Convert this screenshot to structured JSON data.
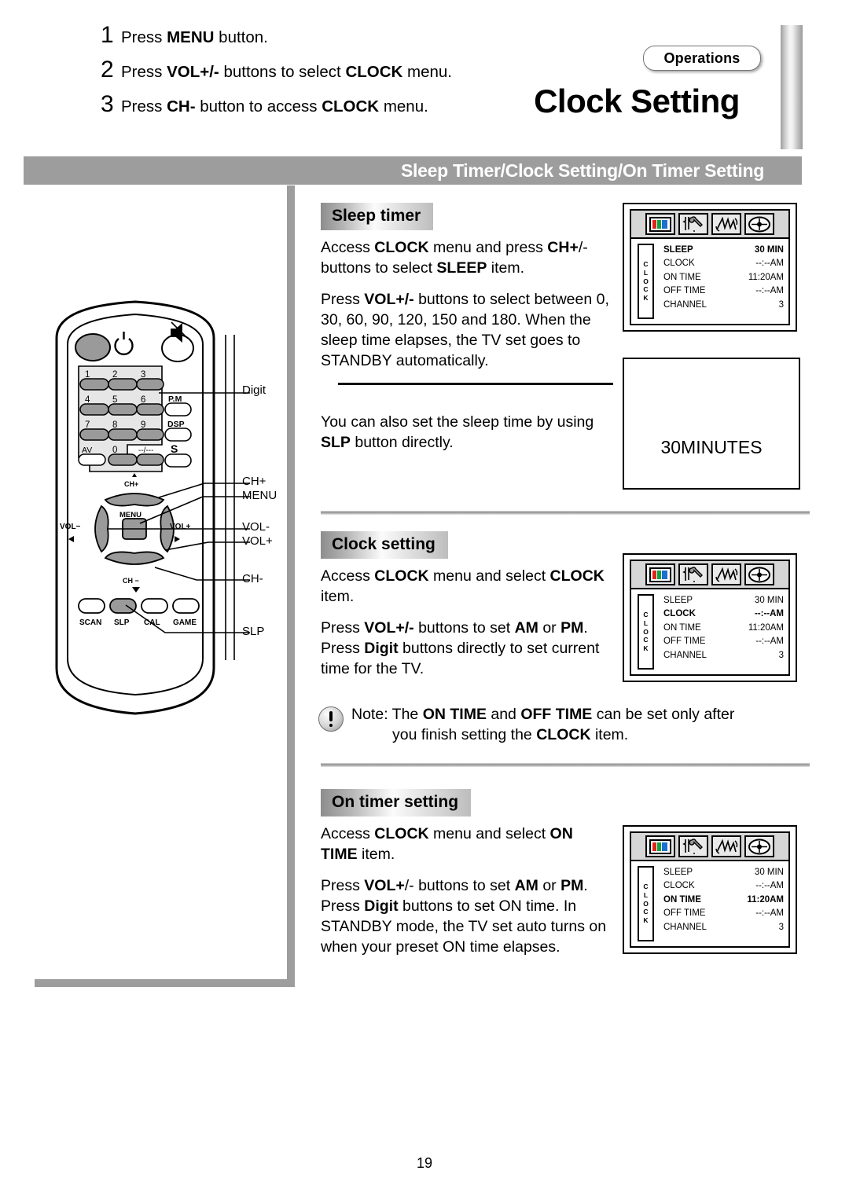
{
  "steps": [
    {
      "num": "1",
      "prefix": "Press ",
      "bold": "MENU",
      "suffix": " button."
    },
    {
      "num": "2",
      "prefix": "Press ",
      "bold": "VOL+/-",
      "mid": " buttons to select ",
      "bold2": "CLOCK",
      "suffix": " menu."
    },
    {
      "num": "3",
      "prefix": "Press ",
      "bold": "CH-",
      "mid": " button to access ",
      "bold2": "CLOCK",
      "suffix": " menu."
    }
  ],
  "header": {
    "badge": "Operations",
    "title": "Clock Setting",
    "banner": "Sleep Timer/Clock Setting/On Timer Setting"
  },
  "remote": {
    "power_icon": "power-icon",
    "mute_icon": "mute-icon",
    "digits": [
      "1",
      "2",
      "3",
      "4",
      "5",
      "6",
      "7",
      "8",
      "9"
    ],
    "bottom_keys": [
      "AV",
      "0",
      "--/---"
    ],
    "side_keys": [
      "P.M",
      "DSP",
      "S"
    ],
    "nav": {
      "up": "CH+",
      "down": "CH −",
      "left": "VOL−",
      "right": "VOL+",
      "center": "MENU"
    },
    "function_keys": [
      "SCAN",
      "SLP",
      "CAL",
      "GAME"
    ],
    "callouts": [
      "Digit",
      "CH+",
      "MENU",
      "VOL-",
      "VOL+",
      "CH-",
      "SLP"
    ]
  },
  "sections": {
    "sleep": {
      "heading": "Sleep timer",
      "p1": "Access CLOCK menu and press CH+/- buttons to select SLEEP item.",
      "p2": "Press VOL+/- buttons to select between 0, 30, 60, 90, 120, 150 and 180. When the sleep time elapses, the TV set goes to STANDBY automatically.",
      "p3": "You can also set the sleep time by using SLP button directly."
    },
    "clock": {
      "heading": "Clock setting",
      "p1": "Access CLOCK menu and select CLOCK item.",
      "p2": "Press VOL+/- buttons to set AM or PM. Press Digit buttons directly to set current time for the TV.",
      "note_line1": "Note: The ON TIME and OFF TIME can be set only after",
      "note_line2": "you finish setting the CLOCK item."
    },
    "ontimer": {
      "heading": "On timer setting",
      "p1": "Access CLOCK menu and select ON TIME item.",
      "p2": "Press VOL+/- buttons to set AM or PM. Press Digit buttons to set ON time. In STANDBY mode, the TV set auto turns on when your preset ON time elapses."
    }
  },
  "osd": {
    "tab_label": "CLOCK",
    "icons": [
      "picture-icon",
      "setup-tools-icon",
      "sound-icon",
      "feature-icon"
    ],
    "menus": [
      {
        "id": "osd-sleep",
        "highlight": "SLEEP",
        "rows": [
          {
            "label": "SLEEP",
            "value": "30 MIN"
          },
          {
            "label": "CLOCK",
            "value": "--:--AM"
          },
          {
            "label": "ON TIME",
            "value": "11:20AM"
          },
          {
            "label": "OFF TIME",
            "value": "--:--AM"
          },
          {
            "label": "CHANNEL",
            "value": "3"
          }
        ]
      },
      {
        "id": "osd-clock",
        "highlight": "CLOCK",
        "rows": [
          {
            "label": "SLEEP",
            "value": "30 MIN"
          },
          {
            "label": "CLOCK",
            "value": "--:--AM"
          },
          {
            "label": "ON TIME",
            "value": "11:20AM"
          },
          {
            "label": "OFF TIME",
            "value": "--:--AM"
          },
          {
            "label": "CHANNEL",
            "value": "3"
          }
        ]
      },
      {
        "id": "osd-ontime",
        "highlight": "ON TIME",
        "rows": [
          {
            "label": "SLEEP",
            "value": "30 MIN"
          },
          {
            "label": "CLOCK",
            "value": "--:--AM"
          },
          {
            "label": "ON TIME",
            "value": "11:20AM"
          },
          {
            "label": "OFF TIME",
            "value": "--:--AM"
          },
          {
            "label": "CHANNEL",
            "value": "3"
          }
        ]
      }
    ]
  },
  "sleep_display": "30MINUTES",
  "page_number": "19",
  "colors": {
    "banner_gray": "#9d9d9d",
    "frame_gray": "#9d9d9d",
    "button_gray": "#9a9a9a",
    "icon_red": "#e2231a",
    "icon_green": "#0aa33f",
    "icon_blue": "#1d6fd0"
  }
}
